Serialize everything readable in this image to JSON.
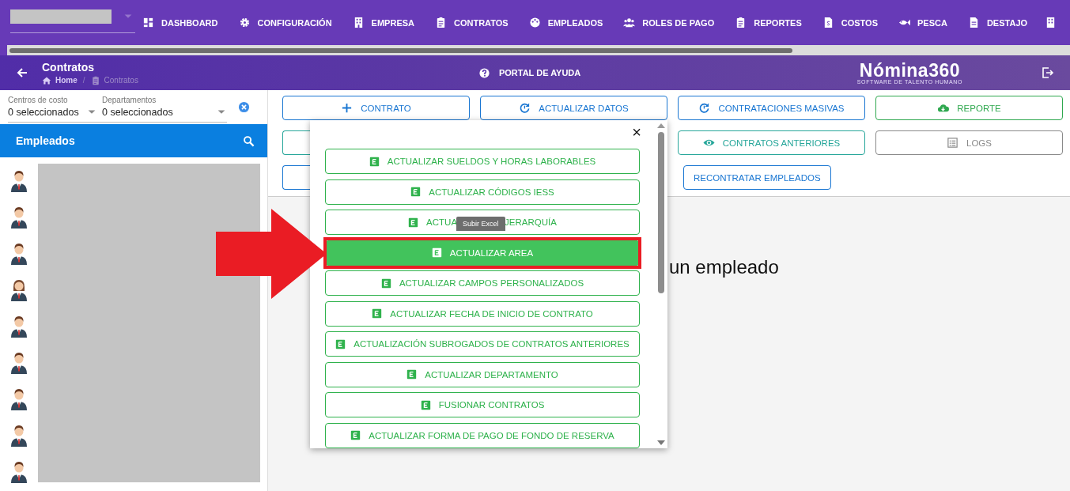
{
  "top_nav": {
    "items": [
      {
        "label": "DASHBOARD"
      },
      {
        "label": "CONFIGURACIÓN"
      },
      {
        "label": "EMPRESA"
      },
      {
        "label": "CONTRATOS"
      },
      {
        "label": "EMPLEADOS"
      },
      {
        "label": "ROLES DE PAGO"
      },
      {
        "label": "REPORTES"
      },
      {
        "label": "COSTOS"
      },
      {
        "label": "PESCA"
      },
      {
        "label": "DESTAJO"
      }
    ]
  },
  "header": {
    "title": "Contratos",
    "breadcrumb": [
      "Home",
      "Contratos"
    ],
    "breadcrumb_separator": "/",
    "help_link": "PORTAL DE AYUDA",
    "logo": {
      "name": "Nómina360",
      "tagline": "SOFTWARE DE TALENTO HUMANO"
    }
  },
  "sidebar": {
    "filters": [
      {
        "label": "Centros de costo",
        "value": "0 seleccionados"
      },
      {
        "label": "Departamentos",
        "value": "0 seleccionados"
      }
    ],
    "title": "Empleados"
  },
  "action_rows": [
    [
      {
        "label": "CONTRATO",
        "color": "#1976d2"
      },
      {
        "label": "ACTUALIZAR DATOS",
        "color": "#1976d2"
      },
      {
        "label": "CONTRATACIONES MASIVAS",
        "color": "#1976d2"
      },
      {
        "label": "REPORTE",
        "color": "#2fa84f"
      }
    ],
    [
      {
        "kind": "covered",
        "color": "#26a69a"
      },
      {
        "label": "CONTRATOS ANTERIORES",
        "color": "#26a69a"
      },
      {
        "label": "LOGS",
        "color": "#8a8a8a"
      }
    ],
    [
      {
        "kind": "covered",
        "color": "#1976d2"
      },
      {
        "label": "RECONTRATAR EMPLEADOS",
        "kind": "compact",
        "color": "#1976d2"
      }
    ]
  ],
  "main_message": "un empleado",
  "popup": {
    "close": "×",
    "items": [
      {
        "label": "ACTUALIZAR SUELDOS Y HORAS LABORABLES",
        "selected": false
      },
      {
        "label": "ACTUALIZAR CÓDIGOS IESS",
        "selected": false
      },
      {
        "label": "ACTUA",
        "label_after": "JERARQUÍA",
        "selected": false,
        "tooltip": "Subir Excel"
      },
      {
        "label": "ACTUALIZAR AREA",
        "selected": true,
        "highlighted": true
      },
      {
        "label": "ACTUALIZAR CAMPOS PERSONALIZADOS",
        "selected": false
      },
      {
        "label": "ACTUALIZAR FECHA DE INICIO DE CONTRATO",
        "selected": false
      },
      {
        "label": "ACTUALIZACIÓN SUBROGADOS DE CONTRATOS ANTERIORES",
        "selected": false
      },
      {
        "label": "ACTUALIZAR DEPARTAMENTO",
        "selected": false
      },
      {
        "label": "FUSIONAR CONTRATOS",
        "selected": false
      },
      {
        "label": "ACTUALIZAR FORMA DE PAGO DE FONDO DE RESERVA",
        "selected": false
      }
    ]
  },
  "annotation": {
    "arrow": true
  }
}
